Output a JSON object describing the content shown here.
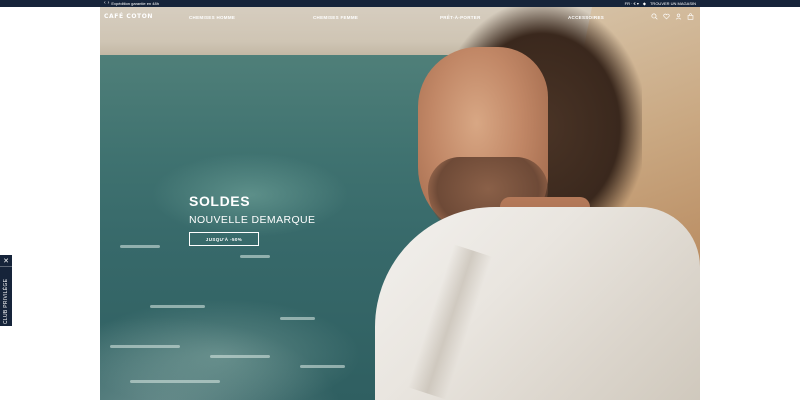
{
  "topbar": {
    "prev_icon": "chevron-left-icon",
    "next_icon": "chevron-right-icon",
    "message": "Expédition garantie en 48h",
    "language": "FR · € ▾",
    "store_locator_icon": "location-pin-icon",
    "store_locator": "TROUVER UN MAGASIN"
  },
  "header": {
    "logo": "CAFÉ COTON",
    "nav": [
      {
        "label": "CHEMISES HOMME"
      },
      {
        "label": "CHEMISES FEMME"
      },
      {
        "label": "PRÊT-À-PORTER"
      },
      {
        "label": "ACCESSOIRES"
      }
    ],
    "icons": [
      "search-icon",
      "heart-icon",
      "user-icon",
      "bag-icon"
    ]
  },
  "hero": {
    "title": "SOLDES",
    "subtitle": "NOUVELLE DEMARQUE",
    "cta": "JUSQU'À -50%"
  },
  "side_tab": {
    "close": "✕",
    "label": "CLUB PRIVILÈGE"
  },
  "colors": {
    "navy": "#16243a",
    "white": "#ffffff"
  }
}
